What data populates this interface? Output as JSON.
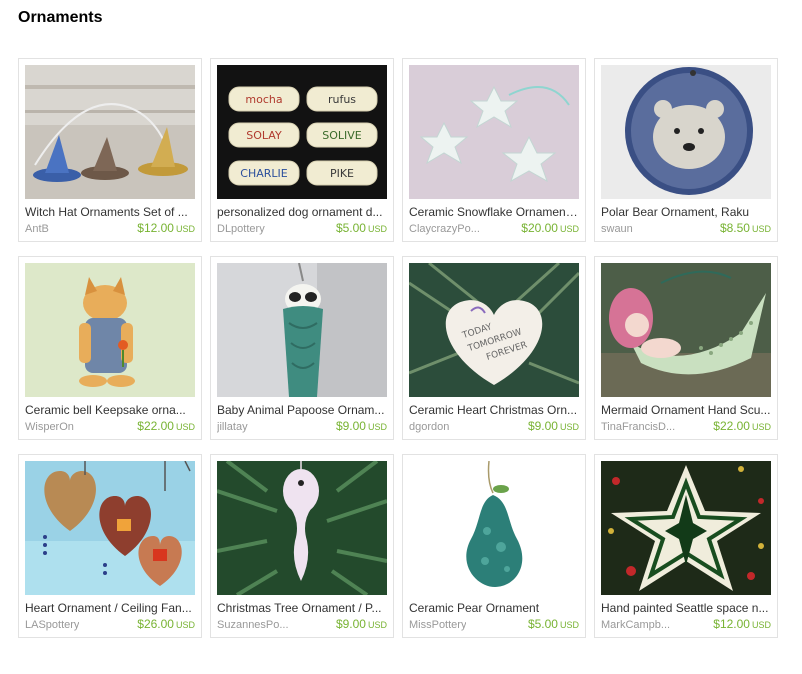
{
  "heading": "Ornaments",
  "items": [
    {
      "title": "Witch Hat Ornaments Set of ...",
      "shop": "AntB",
      "price": "$12.00",
      "currency": "USD",
      "image": "witch-hats-photo"
    },
    {
      "title": "personalized dog ornament d...",
      "shop": "DLpottery",
      "price": "$5.00",
      "currency": "USD",
      "image": "dog-bones-photo",
      "image_text": [
        "mocha",
        "rufus",
        "SOLAY",
        "SOLIVE",
        "CHARLIE",
        "PIKE"
      ]
    },
    {
      "title": "Ceramic Snowflake Ornament...",
      "shop": "ClaycrazyPo...",
      "price": "$20.00",
      "currency": "USD",
      "image": "snowflakes-photo"
    },
    {
      "title": "Polar Bear Ornament, Raku",
      "shop": "swaun",
      "price": "$8.50",
      "currency": "USD",
      "image": "polar-bear-photo"
    },
    {
      "title": "Ceramic bell Keepsake orna...",
      "shop": "WisperOn",
      "price": "$22.00",
      "currency": "USD",
      "image": "ceramic-bell-photo"
    },
    {
      "title": "Baby Animal Papoose Ornam...",
      "shop": "jillatay",
      "price": "$9.00",
      "currency": "USD",
      "image": "papoose-photo"
    },
    {
      "title": "Ceramic Heart Christmas Orn...",
      "shop": "dgordon",
      "price": "$9.00",
      "currency": "USD",
      "image": "heart-photo",
      "image_text": [
        "TODAY",
        "TOMORROW",
        "FOREVER"
      ]
    },
    {
      "title": "Mermaid Ornament Hand Scu...",
      "shop": "TinaFrancisD...",
      "price": "$22.00",
      "currency": "USD",
      "image": "mermaid-photo"
    },
    {
      "title": "Heart Ornament / Ceiling Fan...",
      "shop": "LASpottery",
      "price": "$26.00",
      "currency": "USD",
      "image": "hearts-photo"
    },
    {
      "title": "Christmas Tree Ornament / P...",
      "shop": "SuzannesPo...",
      "price": "$9.00",
      "currency": "USD",
      "image": "tree-ornament-photo"
    },
    {
      "title": "Ceramic Pear Ornament",
      "shop": "MissPottery",
      "price": "$5.00",
      "currency": "USD",
      "image": "pear-photo"
    },
    {
      "title": "Hand painted Seattle space n...",
      "shop": "MarkCampb...",
      "price": "$12.00",
      "currency": "USD",
      "image": "star-photo"
    }
  ],
  "colors": {
    "price": "#78b333",
    "shop": "#999999",
    "title": "#333333",
    "border": "#e2e2e2"
  }
}
